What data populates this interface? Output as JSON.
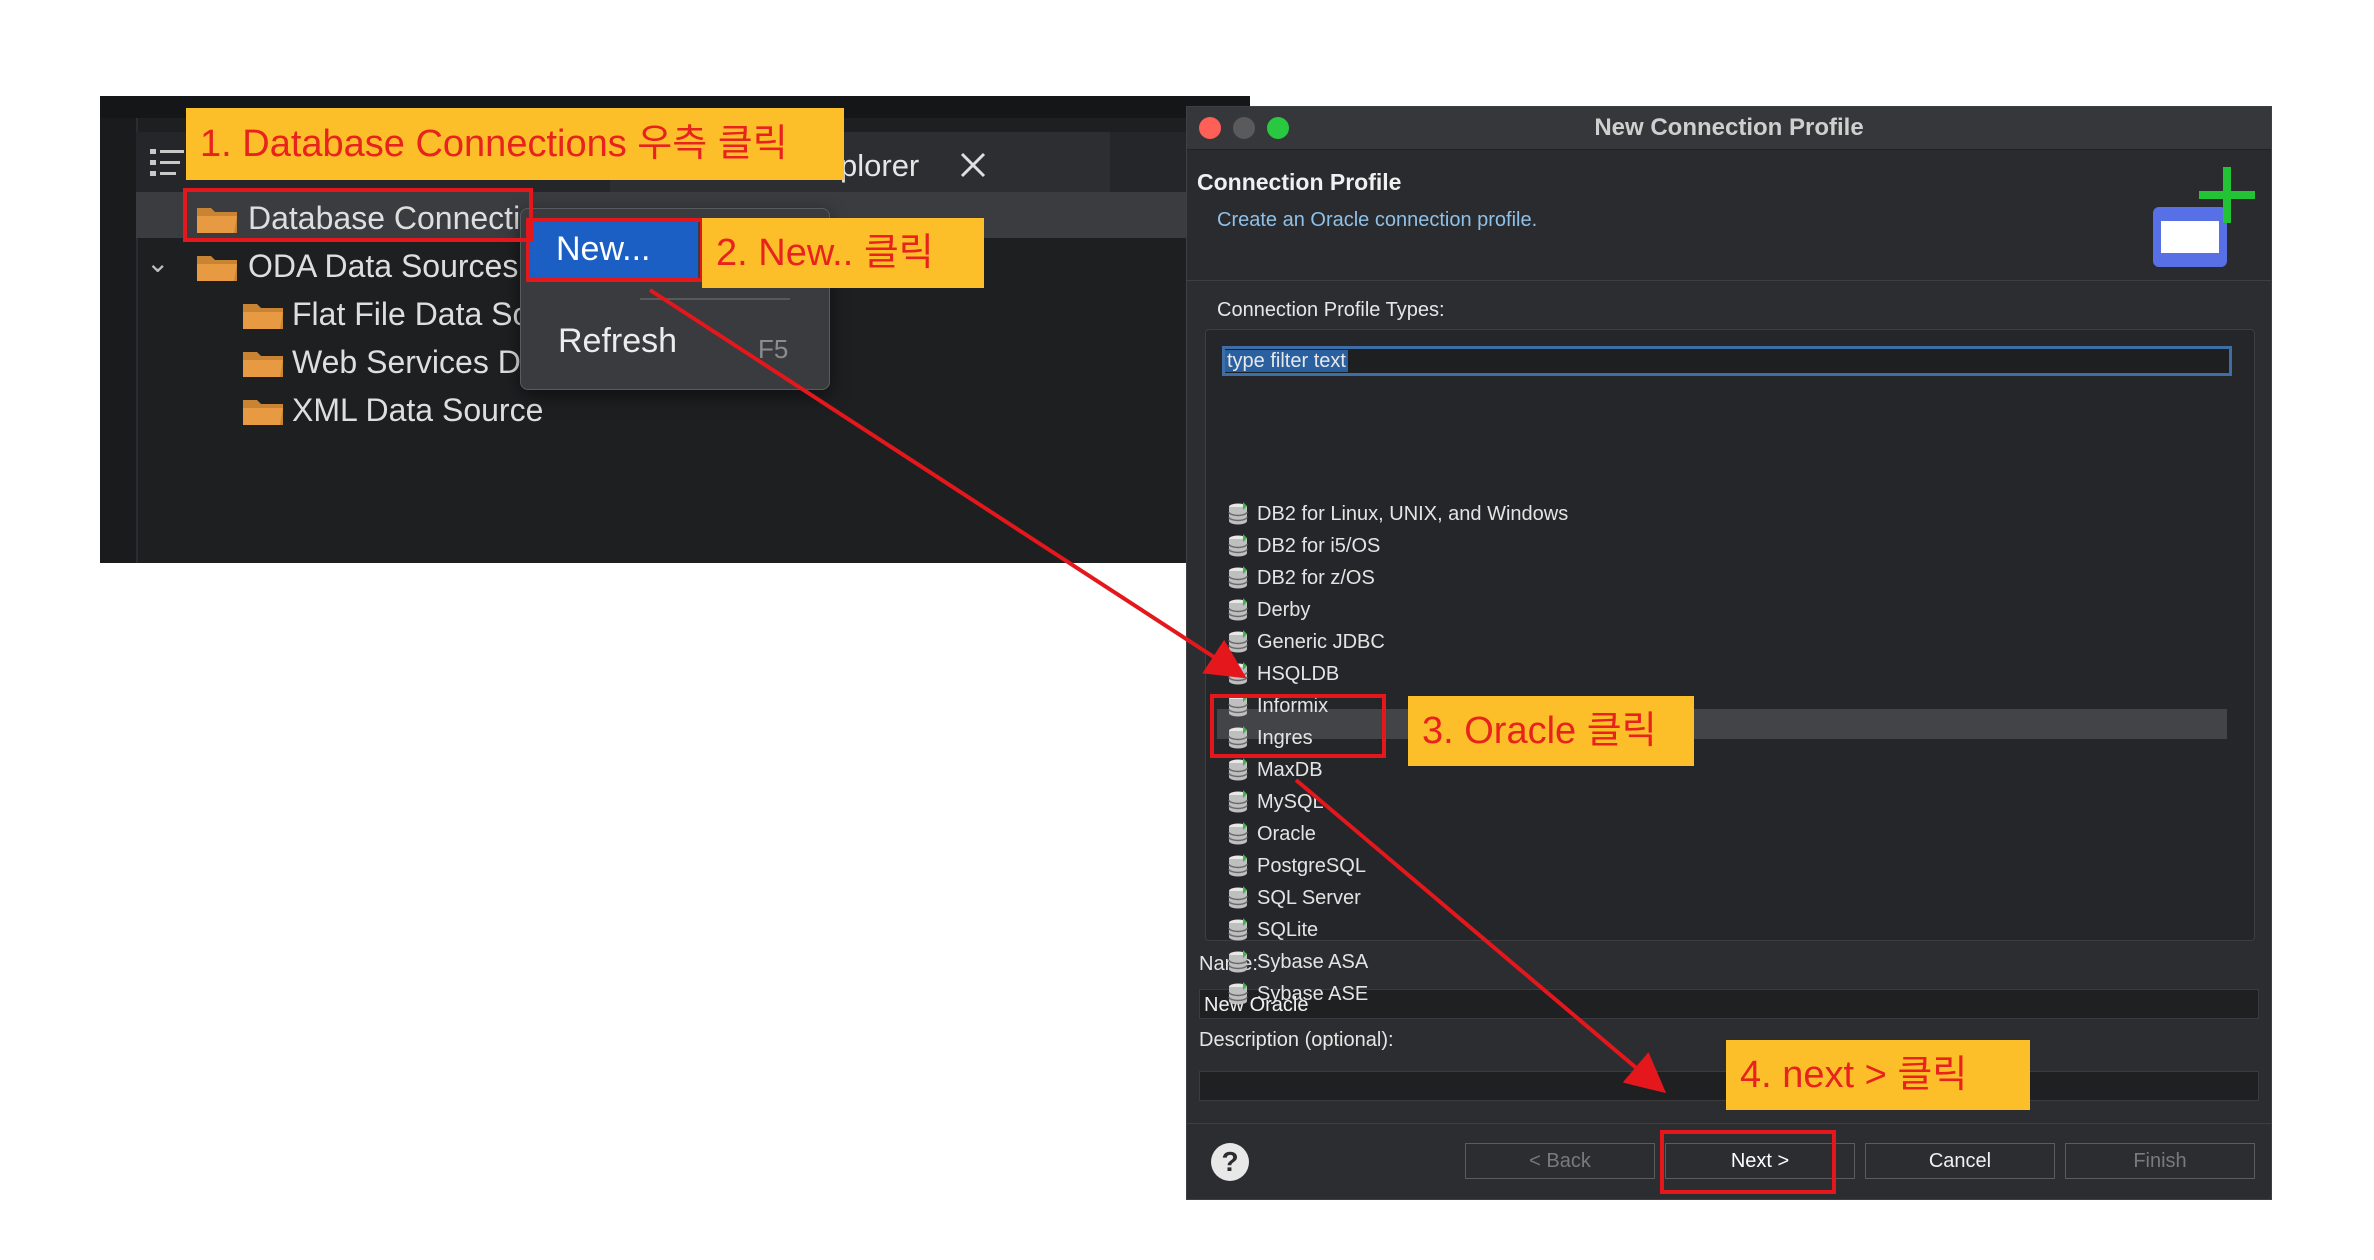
{
  "explorer": {
    "tab_label": "plorer",
    "tab_close_icon": "close-icon",
    "rows": [
      {
        "label": "Database Connecti",
        "icon": "folder-icon",
        "selected": true
      },
      {
        "label": "ODA Data Sources",
        "icon": "folder-icon",
        "expanded": true
      },
      {
        "label": "Flat File Data So",
        "icon": "folder-icon"
      },
      {
        "label": "Web Services D",
        "icon": "folder-icon"
      },
      {
        "label": "XML Data Source",
        "icon": "folder-icon"
      }
    ]
  },
  "context_menu": {
    "items": [
      {
        "label": "New...",
        "highlighted": true
      },
      {
        "label": "Refresh",
        "shortcut": "F5"
      }
    ]
  },
  "dialog": {
    "title": "New Connection Profile",
    "header_title": "Connection Profile",
    "header_subtitle": "Create an Oracle connection profile.",
    "types_label": "Connection Profile Types:",
    "filter_placeholder": "type filter text",
    "profile_types": [
      "DB2 for Linux, UNIX, and Windows",
      "DB2 for i5/OS",
      "DB2 for z/OS",
      "Derby",
      "Generic JDBC",
      "HSQLDB",
      "Informix",
      "Ingres",
      "MaxDB",
      "MySQL",
      "Oracle",
      "PostgreSQL",
      "SQL Server",
      "SQLite",
      "Sybase ASA",
      "Sybase ASE"
    ],
    "selected_type": "Oracle",
    "name_label": "Name:",
    "name_value": "New Oracle",
    "description_label": "Description (optional):",
    "description_value": "",
    "buttons": {
      "help": "?",
      "back": "< Back",
      "next": "Next >",
      "cancel": "Cancel",
      "finish": "Finish"
    }
  },
  "annotations": {
    "step1": "1. Database Connections 우측 클릭",
    "step2": "2. New.. 클릭",
    "step3": "3. Oracle 클릭",
    "step4": "4. next > 클릭"
  },
  "colors": {
    "callout_bg": "#fcbf2a",
    "callout_text": "#e8231d",
    "highlight_box": "#e3171c",
    "menu_highlight": "#1c5fc4",
    "close_light": "#fe5f57",
    "min_light": "#5a5a5c",
    "zoom_light": "#28c840"
  }
}
